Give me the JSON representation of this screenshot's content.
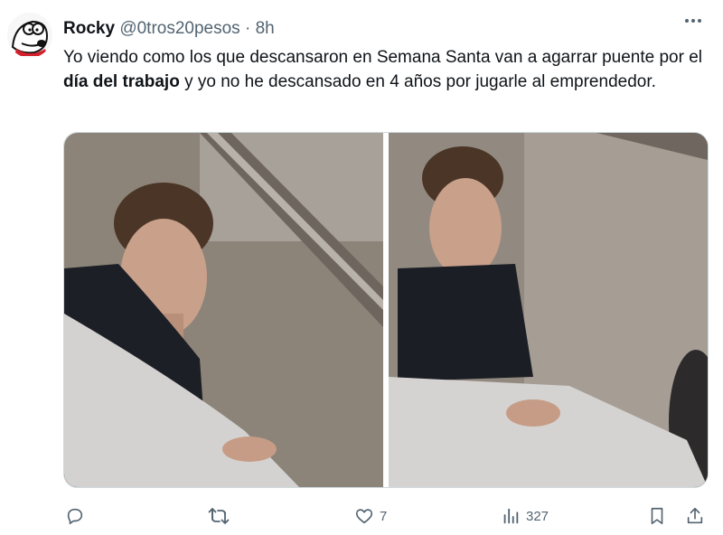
{
  "tweet": {
    "author_name": "Rocky",
    "handle": "@0tros20pesos",
    "separator": "·",
    "time": "8h",
    "more_icon": "more-horizontal-icon",
    "text_part1": "Yo viendo como los que descansaron en Semana Santa van a agarrar puente por el ",
    "text_bold": "día del trabajo",
    "text_part2": " y yo no he descansado en 4 años por jugarle al emprendedor."
  },
  "actions": {
    "reply_count": "",
    "retweet_count": "",
    "like_count": "7",
    "views_count": "327"
  },
  "colors": {
    "text": "#0f1419",
    "muted": "#536471",
    "border": "#cfd9de"
  }
}
